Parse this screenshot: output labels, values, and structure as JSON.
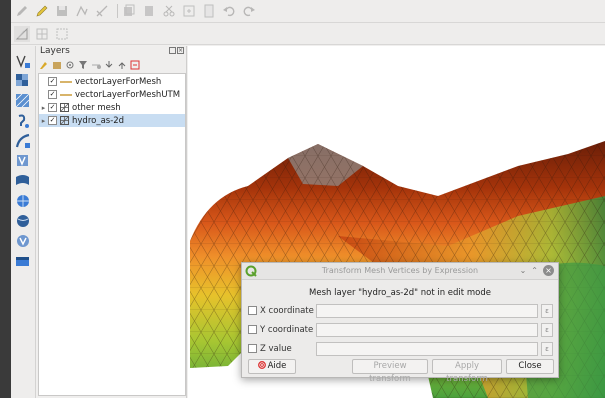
{
  "window": {
    "accent": "#c8ddf2"
  },
  "toolbar_top": {
    "icons": [
      "pencil-icon",
      "edit-pencil-icon",
      "save-layer-icon",
      "digitize-icon",
      "vertex-tool-icon",
      "copy-icon",
      "paste-icon",
      "cut-icon",
      "duplicate-icon",
      "page-icon",
      "undo-icon",
      "redo-icon"
    ]
  },
  "toolbar_second": {
    "icons": [
      "mesh-edit-icon",
      "mesh-grid-icon",
      "mesh-select-icon"
    ]
  },
  "layers_panel": {
    "title": "Layers",
    "tree": [
      {
        "label": "vectorLayerForMesh",
        "checked": true,
        "type": "line",
        "expandable": false,
        "selected": false
      },
      {
        "label": "vectorLayerForMeshUTM",
        "checked": true,
        "type": "line",
        "expandable": false,
        "selected": false
      },
      {
        "label": "other mesh",
        "checked": true,
        "type": "mesh",
        "expandable": true,
        "selected": false
      },
      {
        "label": "hydro_as-2d",
        "checked": true,
        "type": "mesh",
        "expandable": true,
        "selected": true
      }
    ]
  },
  "dialog": {
    "title": "Transform Mesh Vertices by Expression",
    "message": "Mesh layer \"hydro_as-2d\" not in edit mode",
    "fields": [
      {
        "label": "X coordinate",
        "value": ""
      },
      {
        "label": "Y coordinate",
        "value": ""
      },
      {
        "label": "Z value",
        "value": ""
      }
    ],
    "buttons": {
      "help": "Aide",
      "preview": "Preview transform",
      "apply": "Apply transform",
      "close": "Close"
    }
  }
}
